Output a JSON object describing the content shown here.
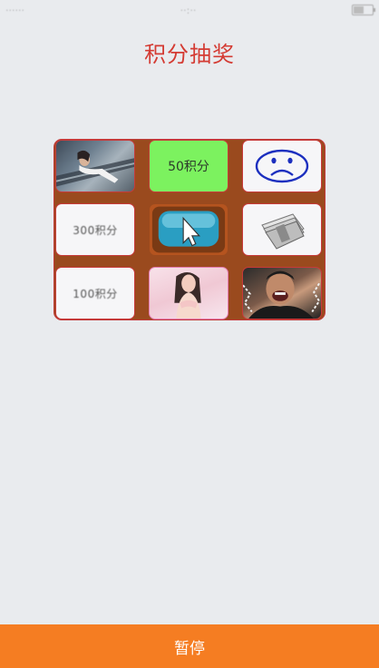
{
  "status_bar": {
    "left": "······",
    "center": "··:··",
    "battery_level": 0.6
  },
  "header": {
    "title": "积分抽奖"
  },
  "prize_grid": {
    "cells": [
      {
        "kind": "photo",
        "icon": "photo-woman-train-icon"
      },
      {
        "kind": "text",
        "label": "50积分"
      },
      {
        "kind": "icon",
        "icon": "sad-face-icon"
      },
      {
        "kind": "text",
        "label": "300积分"
      },
      {
        "kind": "button",
        "icon": "tv-play-button-icon"
      },
      {
        "kind": "icon",
        "icon": "money-stack-icon"
      },
      {
        "kind": "text",
        "label": "100积分"
      },
      {
        "kind": "photo",
        "icon": "photo-woman-pink-icon"
      },
      {
        "kind": "photo",
        "icon": "photo-laughing-man-icon"
      }
    ]
  },
  "footer": {
    "action_label": "暂停"
  },
  "colors": {
    "title": "#d43b33",
    "board": "#9a4a1e",
    "highlight": "#7cf25f",
    "action_bar": "#f57d22"
  }
}
